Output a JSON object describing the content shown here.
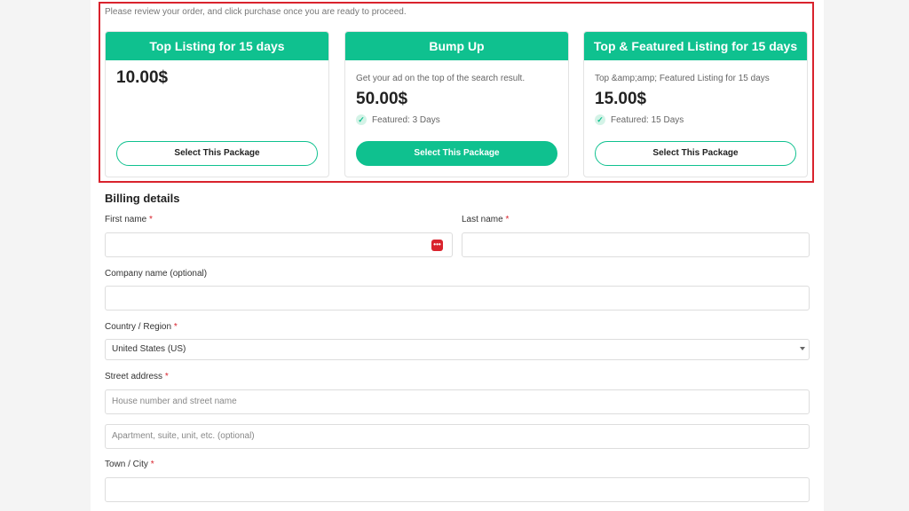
{
  "intro_text": "Please review your order, and click purchase once you are ready to proceed.",
  "packages": [
    {
      "title": "Top Listing for 15 days",
      "description": "",
      "price": "10.00$",
      "feature": "",
      "button_label": "Select This Package"
    },
    {
      "title": "Bump Up",
      "description": "Get your ad on the top of the search result.",
      "price": "50.00$",
      "feature": "Featured: 3 Days",
      "button_label": "Select This Package"
    },
    {
      "title": "Top & Featured Listing for 15 days",
      "description": "Top &amp;amp; Featured Listing for 15 days",
      "price": "15.00$",
      "feature": "Featured: 15 Days",
      "button_label": "Select This Package"
    }
  ],
  "billing": {
    "title": "Billing details",
    "first_name_label": "First name",
    "last_name_label": "Last name",
    "company_label": "Company name (optional)",
    "country_label": "Country / Region",
    "country_value": "United States (US)",
    "street_label": "Street address",
    "street_placeholder_1": "House number and street name",
    "street_placeholder_2": "Apartment, suite, unit, etc. (optional)",
    "city_label": "Town / City",
    "required_mark": "*"
  },
  "colors": {
    "accent": "#0fc18f",
    "highlight": "#d9232d"
  }
}
